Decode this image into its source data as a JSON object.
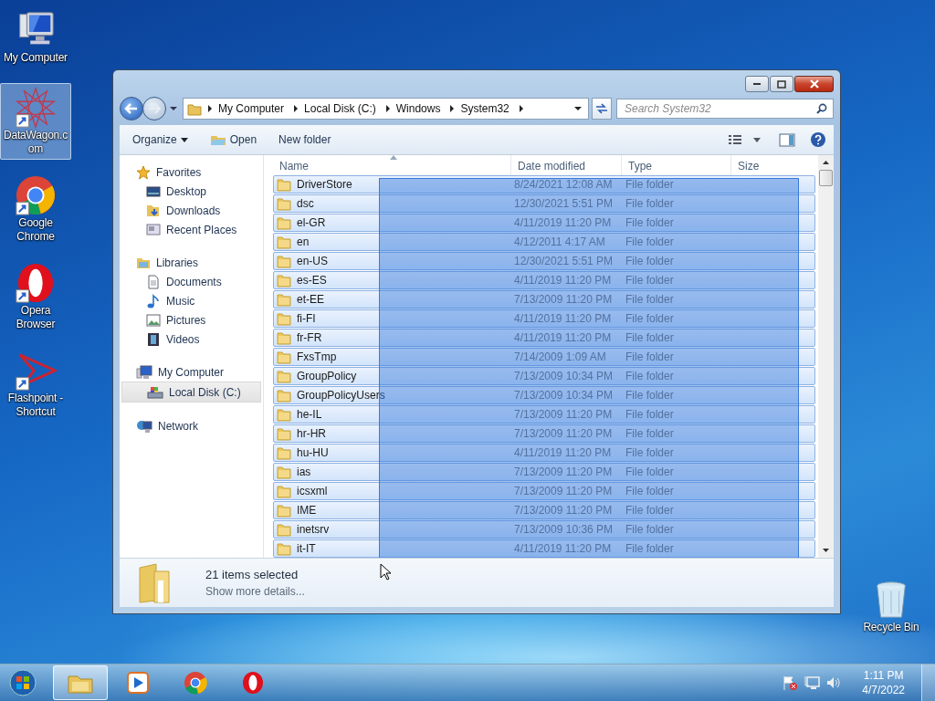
{
  "desktop_icons": [
    {
      "label": "My Computer",
      "kind": "computer",
      "selected": false
    },
    {
      "label": "DataWagon.com",
      "kind": "star",
      "selected": true
    },
    {
      "label": "Google Chrome",
      "kind": "chrome",
      "selected": false
    },
    {
      "label": "Opera Browser",
      "kind": "opera",
      "selected": false
    },
    {
      "label": "Flashpoint - Shortcut",
      "kind": "arrow",
      "selected": false
    }
  ],
  "recycle_bin": {
    "label": "Recycle Bin"
  },
  "window": {
    "address": [
      "My Computer",
      "Local Disk (C:)",
      "Windows",
      "System32"
    ],
    "search": {
      "placeholder": "Search System32"
    },
    "toolbar": [
      {
        "label": "Organize",
        "kind": "menu"
      },
      {
        "label": "Open",
        "kind": "open"
      },
      {
        "label": "New folder",
        "kind": "plain"
      }
    ],
    "sidebar": [
      {
        "label": "Favorites",
        "kind": "star",
        "selected": false,
        "children": [
          {
            "label": "Desktop",
            "kind": "desktop",
            "selected": false
          },
          {
            "label": "Downloads",
            "kind": "downloads",
            "selected": false
          },
          {
            "label": "Recent Places",
            "kind": "recent",
            "selected": false
          }
        ]
      },
      {
        "label": "Libraries",
        "kind": "libraries",
        "selected": false,
        "children": [
          {
            "label": "Documents",
            "kind": "document",
            "selected": false
          },
          {
            "label": "Music",
            "kind": "music",
            "selected": false
          },
          {
            "label": "Pictures",
            "kind": "pictures",
            "selected": false
          },
          {
            "label": "Videos",
            "kind": "videos",
            "selected": false
          }
        ]
      },
      {
        "label": "My Computer",
        "kind": "computer",
        "selected": false,
        "children": [
          {
            "label": "Local Disk (C:)",
            "kind": "disk",
            "selected": true
          }
        ]
      },
      {
        "label": "Network",
        "kind": "network",
        "selected": false
      }
    ],
    "columns": [
      "Name",
      "Date modified",
      "Type",
      "Size"
    ],
    "rows": [
      {
        "name": "DriverStore",
        "date": "8/24/2021 12:08 AM",
        "type": "File folder",
        "selected": true
      },
      {
        "name": "dsc",
        "date": "12/30/2021 5:51 PM",
        "type": "File folder",
        "selected": true
      },
      {
        "name": "el-GR",
        "date": "4/11/2019 11:20 PM",
        "type": "File folder",
        "selected": true
      },
      {
        "name": "en",
        "date": "4/12/2011 4:17 AM",
        "type": "File folder",
        "selected": true
      },
      {
        "name": "en-US",
        "date": "12/30/2021 5:51 PM",
        "type": "File folder",
        "selected": true
      },
      {
        "name": "es-ES",
        "date": "4/11/2019 11:20 PM",
        "type": "File folder",
        "selected": true
      },
      {
        "name": "et-EE",
        "date": "7/13/2009 11:20 PM",
        "type": "File folder",
        "selected": true
      },
      {
        "name": "fi-FI",
        "date": "4/11/2019 11:20 PM",
        "type": "File folder",
        "selected": true
      },
      {
        "name": "fr-FR",
        "date": "4/11/2019 11:20 PM",
        "type": "File folder",
        "selected": true
      },
      {
        "name": "FxsTmp",
        "date": "7/14/2009 1:09 AM",
        "type": "File folder",
        "selected": true
      },
      {
        "name": "GroupPolicy",
        "date": "7/13/2009 10:34 PM",
        "type": "File folder",
        "selected": true
      },
      {
        "name": "GroupPolicyUsers",
        "date": "7/13/2009 10:34 PM",
        "type": "File folder",
        "selected": true
      },
      {
        "name": "he-IL",
        "date": "7/13/2009 11:20 PM",
        "type": "File folder",
        "selected": true
      },
      {
        "name": "hr-HR",
        "date": "7/13/2009 11:20 PM",
        "type": "File folder",
        "selected": true
      },
      {
        "name": "hu-HU",
        "date": "4/11/2019 11:20 PM",
        "type": "File folder",
        "selected": true
      },
      {
        "name": "ias",
        "date": "7/13/2009 11:20 PM",
        "type": "File folder",
        "selected": true
      },
      {
        "name": "icsxml",
        "date": "7/13/2009 11:20 PM",
        "type": "File folder",
        "selected": true
      },
      {
        "name": "IME",
        "date": "7/13/2009 11:20 PM",
        "type": "File folder",
        "selected": true
      },
      {
        "name": "inetsrv",
        "date": "7/13/2009 10:36 PM",
        "type": "File folder",
        "selected": true
      },
      {
        "name": "it-IT",
        "date": "4/11/2019 11:20 PM",
        "type": "File folder",
        "selected": true
      }
    ],
    "details": {
      "summary": "21 items selected",
      "link": "Show more details..."
    }
  },
  "taskbar": {
    "items": [
      {
        "kind": "explorer",
        "selected": true
      },
      {
        "kind": "media",
        "selected": false
      },
      {
        "kind": "chrome",
        "selected": false
      },
      {
        "kind": "opera",
        "selected": false
      }
    ],
    "clock": {
      "time": "1:11 PM",
      "date": "4/7/2022"
    }
  }
}
